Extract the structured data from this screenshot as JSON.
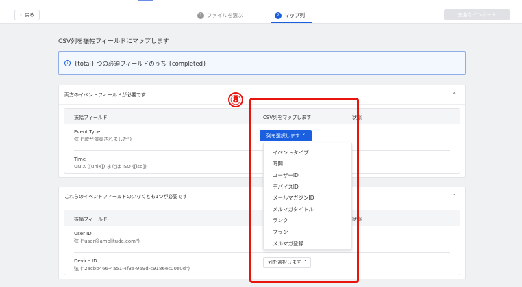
{
  "header": {
    "back_label": "戻る",
    "steps": [
      {
        "num": "1",
        "label": "ファイルを選ぶ"
      },
      {
        "num": "2",
        "label": "マップ列"
      }
    ],
    "import_label": "完全なインポート"
  },
  "page_title": "CSV列を振幅フィールドにマップします",
  "info": {
    "text": "{total} つの必須フィールドのうち {completed}"
  },
  "columns": {
    "field": "振幅フィールド",
    "csv": "CSV列をマップします",
    "status": "状態"
  },
  "section1": {
    "title": "両方のイベントフィールドが必要です",
    "rows": [
      {
        "name": "Event Type",
        "desc": "弦 (\"歌が演奏されました\")"
      },
      {
        "name": "Time",
        "desc": "UNIX ([unix]) または ISO ([iso])"
      }
    ]
  },
  "section2": {
    "title": "これらのイベントフィールドの少なくとも1つが必要です",
    "rows": [
      {
        "name": "User ID",
        "desc": "弦 (\"user@amplitude.com\")"
      },
      {
        "name": "Device ID",
        "desc": "弦 (\"2acbb466-4a51-4f3a-969d-c9186ec00e0d\")"
      }
    ]
  },
  "select_label": "列を選択します",
  "dropdown_options": [
    "イベントタイプ",
    "時間",
    "ユーザーID",
    "デバイスID",
    "メールマガジンID",
    "メルマガタイトル",
    "ランク",
    "プラン",
    "メルマガ登録"
  ],
  "annotation": "⑧",
  "colors": {
    "accent": "#1a5fe0",
    "annotation": "#e8150f"
  }
}
